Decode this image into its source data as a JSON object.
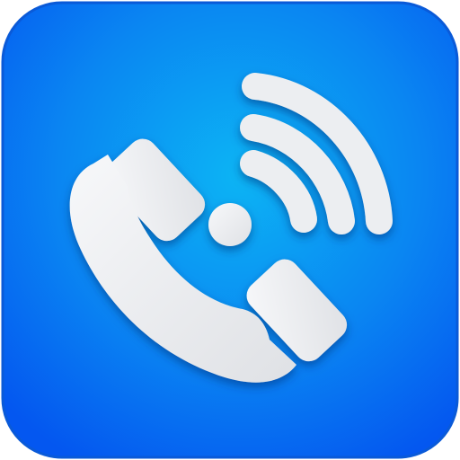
{
  "icon": {
    "name": "phone-call-app-icon",
    "glyph": "phone-handset-with-signal-waves",
    "colors": {
      "background_center": "#0cb4f4",
      "background_edge": "#0457f0",
      "border": "#0a5ad8",
      "glyph": "#eeeff1",
      "glyph_shadow": "#06317a"
    }
  }
}
